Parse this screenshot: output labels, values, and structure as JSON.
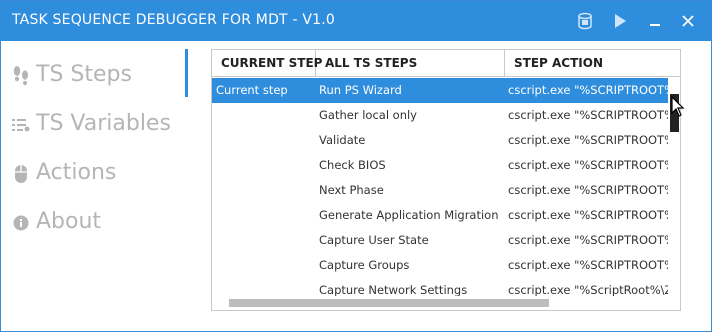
{
  "window": {
    "title": "TASK SEQUENCE DEBUGGER FOR MDT - V1.0",
    "controls": [
      "save-icon",
      "play-icon",
      "minimize-icon",
      "close-icon"
    ],
    "accent_color": "#2f8ddd"
  },
  "sidebar": {
    "items": [
      {
        "label": "TS Steps",
        "icon": "footsteps-icon",
        "active": true
      },
      {
        "label": "TS Variables",
        "icon": "list-icon",
        "active": false
      },
      {
        "label": "Actions",
        "icon": "mouse-icon",
        "active": false
      },
      {
        "label": "About",
        "icon": "info-icon",
        "active": false
      }
    ]
  },
  "grid": {
    "columns": [
      "CURRENT STEP",
      "ALL TS STEPS",
      "STEP ACTION"
    ],
    "rows": [
      {
        "current": "Current step",
        "step": "Run PS Wizard",
        "action": "cscript.exe \"%SCRIPTROOT%\\Z",
        "selected": true
      },
      {
        "current": "",
        "step": "Gather local only",
        "action": "cscript.exe \"%SCRIPTROOT%\\Z"
      },
      {
        "current": "",
        "step": "Validate",
        "action": "cscript.exe \"%SCRIPTROOT%\\Z"
      },
      {
        "current": "",
        "step": "Check BIOS",
        "action": "cscript.exe \"%SCRIPTROOT%\\Z"
      },
      {
        "current": "",
        "step": "Next Phase",
        "action": "cscript.exe \"%SCRIPTROOT%\\Z"
      },
      {
        "current": "",
        "step": "Generate Application Migration File",
        "action": "cscript.exe \"%SCRIPTROOT%\\Z"
      },
      {
        "current": "",
        "step": "Capture User State",
        "action": "cscript.exe \"%SCRIPTROOT%\\Z"
      },
      {
        "current": "",
        "step": "Capture Groups",
        "action": "cscript.exe \"%SCRIPTROOT%\\Z"
      },
      {
        "current": "",
        "step": "Capture Network Settings",
        "action": "cscript.exe \"%ScriptRoot%\\ZTIN"
      }
    ]
  }
}
